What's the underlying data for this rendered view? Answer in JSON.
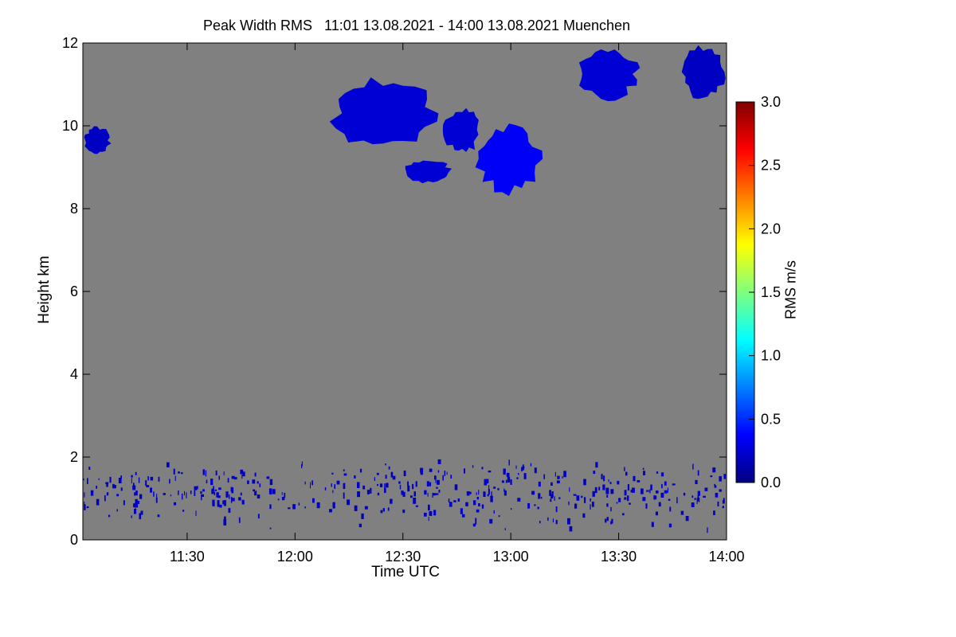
{
  "chart_data": {
    "type": "heatmap",
    "title": "Peak Width RMS   11:01 13.08.2021 - 14:00 13.08.2021 Muenchen",
    "xlabel": "Time UTC",
    "ylabel": "Height km",
    "x_range_hours": [
      11.0167,
      14.0
    ],
    "x_ticks": [
      "11:30",
      "12:00",
      "12:30",
      "13:00",
      "13:30",
      "14:00"
    ],
    "x_tick_values_hours": [
      11.5,
      12.0,
      12.5,
      13.0,
      13.5,
      14.0
    ],
    "ylim": [
      0,
      12
    ],
    "y_ticks": [
      0,
      2,
      4,
      6,
      8,
      10,
      12
    ],
    "background_color": "#808080",
    "grid": false,
    "colorbar": {
      "label": "RMS m/s",
      "range": [
        0.0,
        3.0
      ],
      "ticks": [
        "0.0",
        "0.5",
        "1.0",
        "1.5",
        "2.0",
        "2.5",
        "3.0"
      ],
      "colors": [
        "#00007f",
        "#0000ff",
        "#007fff",
        "#00ffff",
        "#7fff7f",
        "#ffff00",
        "#ff7f00",
        "#ff0000",
        "#7f0000"
      ]
    },
    "cloud_echoes": [
      {
        "name": "left-cloud",
        "time_start": "11:01",
        "time_end": "11:09",
        "height_km": [
          9.3,
          10.0
        ],
        "rms": 0.2
      },
      {
        "name": "main-cloud-1",
        "time_start": "12:09",
        "time_end": "12:40",
        "height_km": [
          9.4,
          11.2
        ],
        "rms": 0.25
      },
      {
        "name": "main-cloud-1-base",
        "time_start": "12:30",
        "time_end": "12:44",
        "height_km": [
          8.6,
          9.2
        ],
        "rms": 0.25
      },
      {
        "name": "main-cloud-2",
        "time_start": "12:41",
        "time_end": "12:52",
        "height_km": [
          9.3,
          10.5
        ],
        "rms": 0.25
      },
      {
        "name": "cloud-1300",
        "time_start": "12:50",
        "time_end": "13:09",
        "height_km": [
          8.3,
          10.1
        ],
        "rms": 0.35
      },
      {
        "name": "cloud-1330",
        "time_start": "13:18",
        "time_end": "13:36",
        "height_km": [
          10.6,
          11.9
        ],
        "rms": 0.25
      },
      {
        "name": "cloud-right",
        "time_start": "13:47",
        "time_end": "14:00",
        "height_km": [
          10.6,
          12.0
        ],
        "rms": 0.2
      }
    ],
    "boundary_layer_echoes": {
      "time_start": "11:01",
      "time_end": "14:00",
      "height_km": [
        0.1,
        2.0
      ],
      "rms": 0.2
    }
  }
}
